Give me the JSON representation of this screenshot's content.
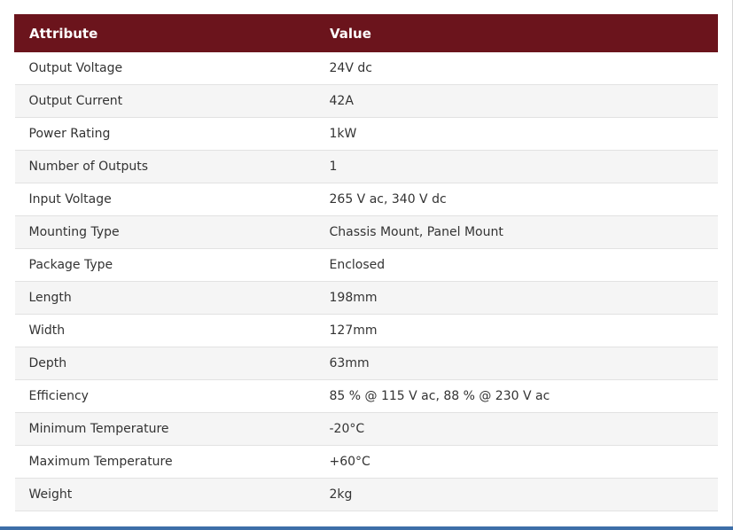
{
  "table": {
    "headers": [
      "Attribute",
      "Value"
    ],
    "rows": [
      [
        "Output Voltage",
        "24V dc"
      ],
      [
        "Output Current",
        "42A"
      ],
      [
        "Power Rating",
        "1kW"
      ],
      [
        "Number of Outputs",
        "1"
      ],
      [
        "Input Voltage",
        "265 V ac, 340 V dc"
      ],
      [
        "Mounting Type",
        "Chassis Mount, Panel Mount"
      ],
      [
        "Package Type",
        "Enclosed"
      ],
      [
        "Length",
        "198mm"
      ],
      [
        "Width",
        "127mm"
      ],
      [
        "Depth",
        "63mm"
      ],
      [
        "Efficiency",
        "85 % @ 115 V ac, 88 % @ 230 V ac"
      ],
      [
        "Minimum Temperature",
        "-20°C"
      ],
      [
        "Maximum Temperature",
        "+60°C"
      ],
      [
        "Weight",
        "2kg"
      ]
    ]
  },
  "colors": {
    "header_bg": "#6b141c",
    "header_text": "#ffffff",
    "row_alt_bg": "#f5f5f5",
    "bottom_bar": "#3d6ea8"
  }
}
